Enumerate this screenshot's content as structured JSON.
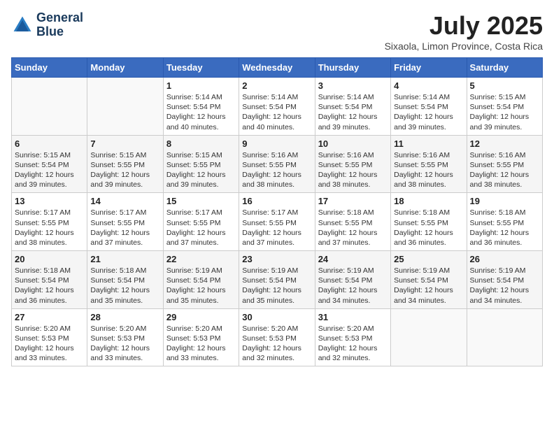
{
  "logo": {
    "line1": "General",
    "line2": "Blue"
  },
  "title": "July 2025",
  "location": "Sixaola, Limon Province, Costa Rica",
  "weekdays": [
    "Sunday",
    "Monday",
    "Tuesday",
    "Wednesday",
    "Thursday",
    "Friday",
    "Saturday"
  ],
  "weeks": [
    [
      {
        "day": "",
        "sunrise": "",
        "sunset": "",
        "daylight": ""
      },
      {
        "day": "",
        "sunrise": "",
        "sunset": "",
        "daylight": ""
      },
      {
        "day": "1",
        "sunrise": "Sunrise: 5:14 AM",
        "sunset": "Sunset: 5:54 PM",
        "daylight": "Daylight: 12 hours and 40 minutes."
      },
      {
        "day": "2",
        "sunrise": "Sunrise: 5:14 AM",
        "sunset": "Sunset: 5:54 PM",
        "daylight": "Daylight: 12 hours and 40 minutes."
      },
      {
        "day": "3",
        "sunrise": "Sunrise: 5:14 AM",
        "sunset": "Sunset: 5:54 PM",
        "daylight": "Daylight: 12 hours and 39 minutes."
      },
      {
        "day": "4",
        "sunrise": "Sunrise: 5:14 AM",
        "sunset": "Sunset: 5:54 PM",
        "daylight": "Daylight: 12 hours and 39 minutes."
      },
      {
        "day": "5",
        "sunrise": "Sunrise: 5:15 AM",
        "sunset": "Sunset: 5:54 PM",
        "daylight": "Daylight: 12 hours and 39 minutes."
      }
    ],
    [
      {
        "day": "6",
        "sunrise": "Sunrise: 5:15 AM",
        "sunset": "Sunset: 5:54 PM",
        "daylight": "Daylight: 12 hours and 39 minutes."
      },
      {
        "day": "7",
        "sunrise": "Sunrise: 5:15 AM",
        "sunset": "Sunset: 5:55 PM",
        "daylight": "Daylight: 12 hours and 39 minutes."
      },
      {
        "day": "8",
        "sunrise": "Sunrise: 5:15 AM",
        "sunset": "Sunset: 5:55 PM",
        "daylight": "Daylight: 12 hours and 39 minutes."
      },
      {
        "day": "9",
        "sunrise": "Sunrise: 5:16 AM",
        "sunset": "Sunset: 5:55 PM",
        "daylight": "Daylight: 12 hours and 38 minutes."
      },
      {
        "day": "10",
        "sunrise": "Sunrise: 5:16 AM",
        "sunset": "Sunset: 5:55 PM",
        "daylight": "Daylight: 12 hours and 38 minutes."
      },
      {
        "day": "11",
        "sunrise": "Sunrise: 5:16 AM",
        "sunset": "Sunset: 5:55 PM",
        "daylight": "Daylight: 12 hours and 38 minutes."
      },
      {
        "day": "12",
        "sunrise": "Sunrise: 5:16 AM",
        "sunset": "Sunset: 5:55 PM",
        "daylight": "Daylight: 12 hours and 38 minutes."
      }
    ],
    [
      {
        "day": "13",
        "sunrise": "Sunrise: 5:17 AM",
        "sunset": "Sunset: 5:55 PM",
        "daylight": "Daylight: 12 hours and 38 minutes."
      },
      {
        "day": "14",
        "sunrise": "Sunrise: 5:17 AM",
        "sunset": "Sunset: 5:55 PM",
        "daylight": "Daylight: 12 hours and 37 minutes."
      },
      {
        "day": "15",
        "sunrise": "Sunrise: 5:17 AM",
        "sunset": "Sunset: 5:55 PM",
        "daylight": "Daylight: 12 hours and 37 minutes."
      },
      {
        "day": "16",
        "sunrise": "Sunrise: 5:17 AM",
        "sunset": "Sunset: 5:55 PM",
        "daylight": "Daylight: 12 hours and 37 minutes."
      },
      {
        "day": "17",
        "sunrise": "Sunrise: 5:18 AM",
        "sunset": "Sunset: 5:55 PM",
        "daylight": "Daylight: 12 hours and 37 minutes."
      },
      {
        "day": "18",
        "sunrise": "Sunrise: 5:18 AM",
        "sunset": "Sunset: 5:55 PM",
        "daylight": "Daylight: 12 hours and 36 minutes."
      },
      {
        "day": "19",
        "sunrise": "Sunrise: 5:18 AM",
        "sunset": "Sunset: 5:55 PM",
        "daylight": "Daylight: 12 hours and 36 minutes."
      }
    ],
    [
      {
        "day": "20",
        "sunrise": "Sunrise: 5:18 AM",
        "sunset": "Sunset: 5:54 PM",
        "daylight": "Daylight: 12 hours and 36 minutes."
      },
      {
        "day": "21",
        "sunrise": "Sunrise: 5:18 AM",
        "sunset": "Sunset: 5:54 PM",
        "daylight": "Daylight: 12 hours and 35 minutes."
      },
      {
        "day": "22",
        "sunrise": "Sunrise: 5:19 AM",
        "sunset": "Sunset: 5:54 PM",
        "daylight": "Daylight: 12 hours and 35 minutes."
      },
      {
        "day": "23",
        "sunrise": "Sunrise: 5:19 AM",
        "sunset": "Sunset: 5:54 PM",
        "daylight": "Daylight: 12 hours and 35 minutes."
      },
      {
        "day": "24",
        "sunrise": "Sunrise: 5:19 AM",
        "sunset": "Sunset: 5:54 PM",
        "daylight": "Daylight: 12 hours and 34 minutes."
      },
      {
        "day": "25",
        "sunrise": "Sunrise: 5:19 AM",
        "sunset": "Sunset: 5:54 PM",
        "daylight": "Daylight: 12 hours and 34 minutes."
      },
      {
        "day": "26",
        "sunrise": "Sunrise: 5:19 AM",
        "sunset": "Sunset: 5:54 PM",
        "daylight": "Daylight: 12 hours and 34 minutes."
      }
    ],
    [
      {
        "day": "27",
        "sunrise": "Sunrise: 5:20 AM",
        "sunset": "Sunset: 5:53 PM",
        "daylight": "Daylight: 12 hours and 33 minutes."
      },
      {
        "day": "28",
        "sunrise": "Sunrise: 5:20 AM",
        "sunset": "Sunset: 5:53 PM",
        "daylight": "Daylight: 12 hours and 33 minutes."
      },
      {
        "day": "29",
        "sunrise": "Sunrise: 5:20 AM",
        "sunset": "Sunset: 5:53 PM",
        "daylight": "Daylight: 12 hours and 33 minutes."
      },
      {
        "day": "30",
        "sunrise": "Sunrise: 5:20 AM",
        "sunset": "Sunset: 5:53 PM",
        "daylight": "Daylight: 12 hours and 32 minutes."
      },
      {
        "day": "31",
        "sunrise": "Sunrise: 5:20 AM",
        "sunset": "Sunset: 5:53 PM",
        "daylight": "Daylight: 12 hours and 32 minutes."
      },
      {
        "day": "",
        "sunrise": "",
        "sunset": "",
        "daylight": ""
      },
      {
        "day": "",
        "sunrise": "",
        "sunset": "",
        "daylight": ""
      }
    ]
  ]
}
